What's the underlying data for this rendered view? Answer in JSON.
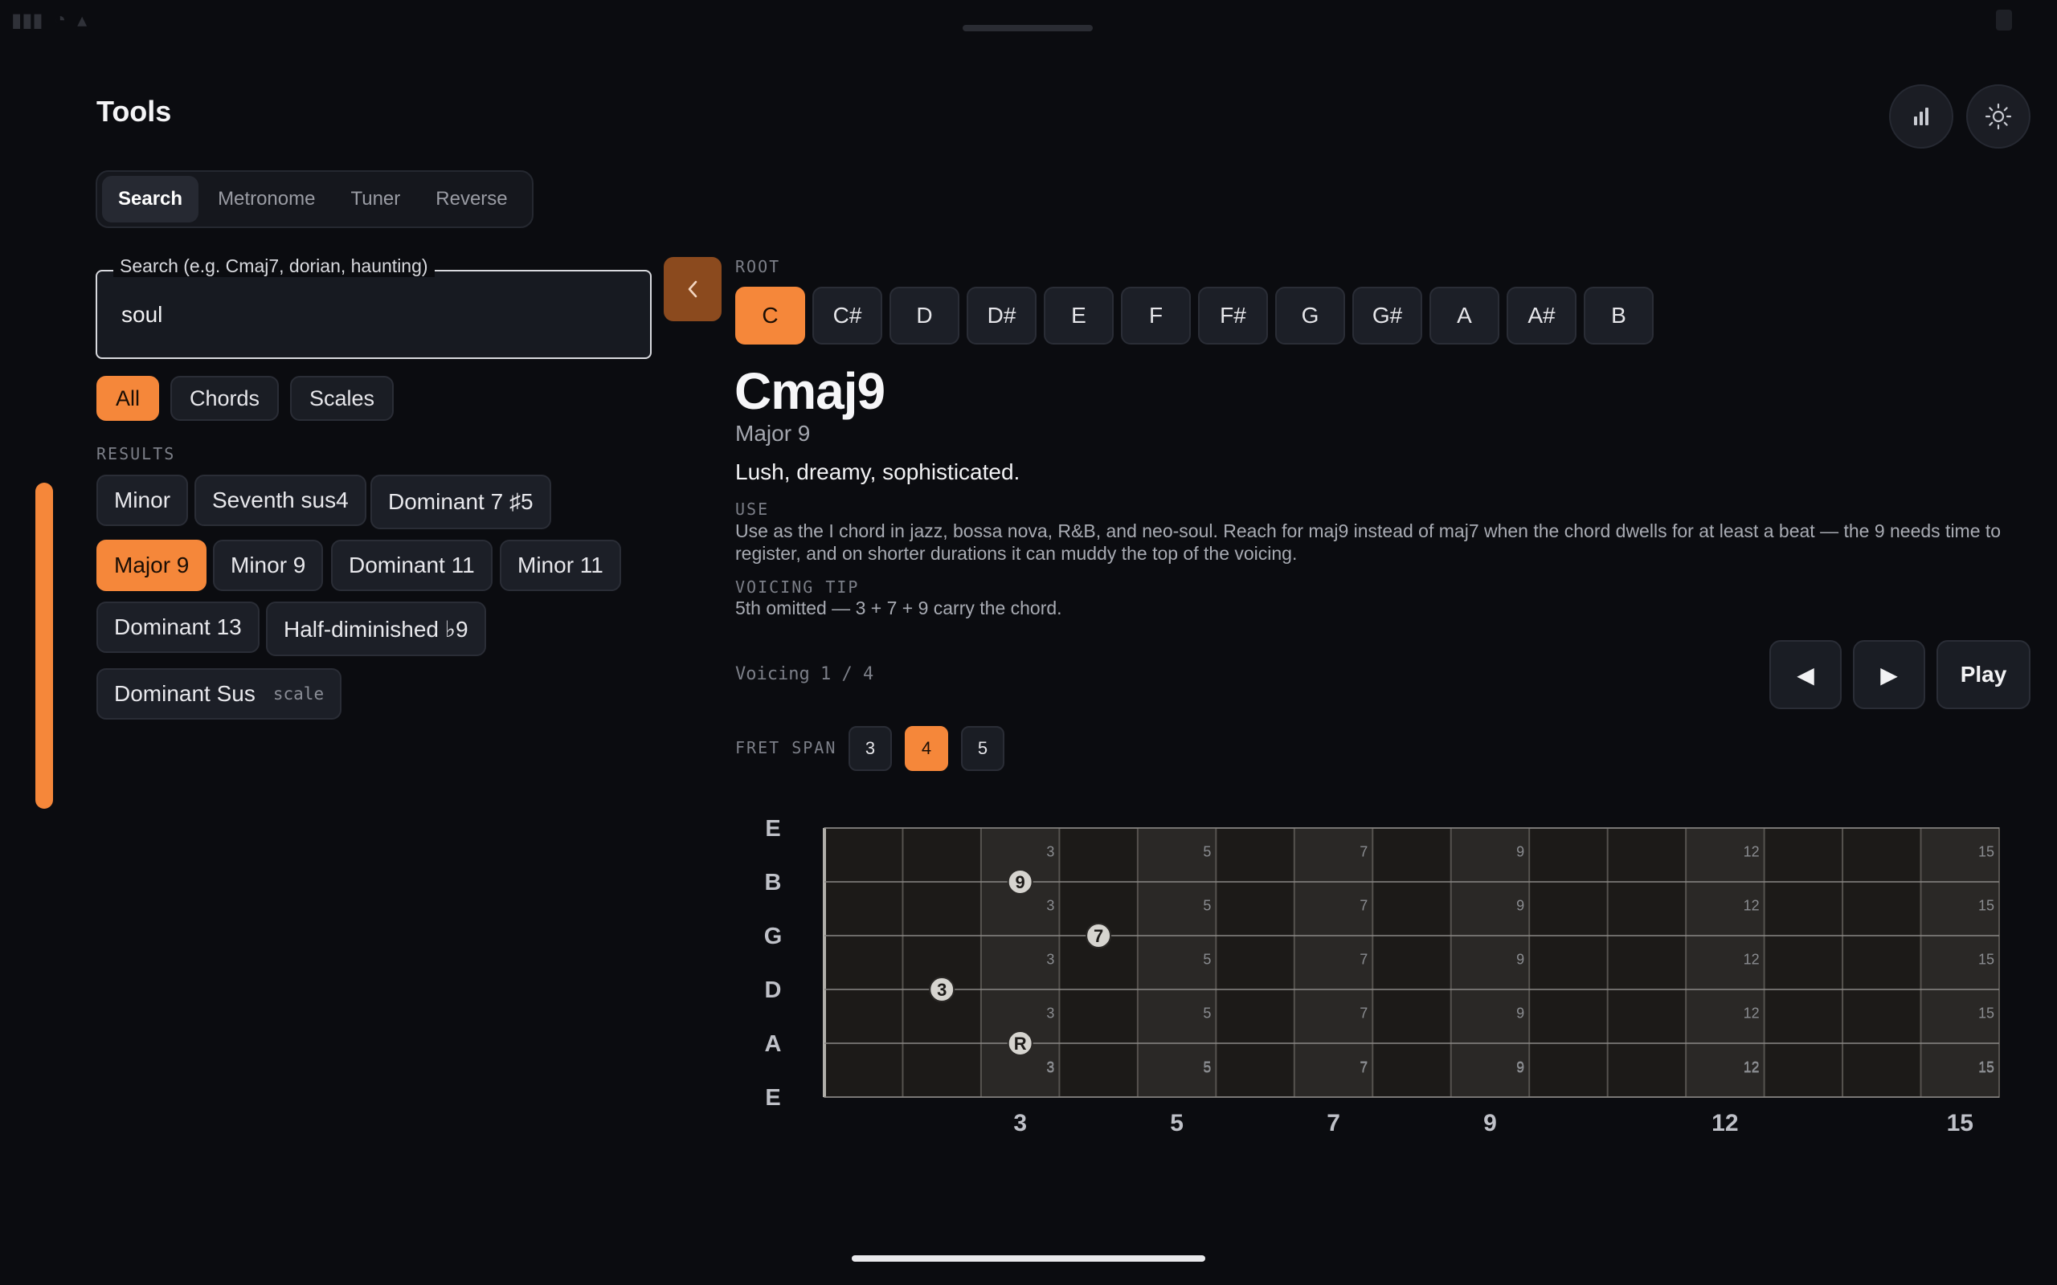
{
  "header": {
    "title": "Tools"
  },
  "tabs": [
    {
      "label": "Search",
      "active": true
    },
    {
      "label": "Metronome",
      "active": false
    },
    {
      "label": "Tuner",
      "active": false
    },
    {
      "label": "Reverse",
      "active": false
    }
  ],
  "search": {
    "label": "Search (e.g. Cmaj7, dorian, haunting)",
    "value": "soul"
  },
  "filters": {
    "all": "All",
    "chords": "Chords",
    "scales": "Scales",
    "selected": "All"
  },
  "results": {
    "label": "RESULTS",
    "items": [
      {
        "label": "Minor"
      },
      {
        "label": "Seventh sus4"
      },
      {
        "label": "Dominant 7 ♯5"
      },
      {
        "label": "Major 9",
        "active": true
      },
      {
        "label": "Minor 9"
      },
      {
        "label": "Dominant 11"
      },
      {
        "label": "Minor 11"
      },
      {
        "label": "Dominant 13"
      },
      {
        "label": "Half-diminished ♭9"
      },
      {
        "label": "Dominant Sus",
        "tag": "scale"
      }
    ]
  },
  "root": {
    "label": "ROOT",
    "keys": [
      "C",
      "C#",
      "D",
      "D#",
      "E",
      "F",
      "F#",
      "G",
      "G#",
      "A",
      "A#",
      "B"
    ],
    "selected": "C"
  },
  "chord": {
    "name": "Cmaj9",
    "full_name": "Major 9",
    "mood": "Lush, dreamy, sophisticated.",
    "use_label": "USE",
    "use_text": "Use as the I chord in jazz, bossa nova, R&B, and neo-soul. Reach for maj9 instead of maj7 when the chord dwells for at least a beat — the 9 needs time to register, and on shorter durations it can muddy the top of the voicing.",
    "voicing_tip_label": "VOICING TIP",
    "voicing_tip_text": "5th omitted — 3 + 7 + 9 carry the chord."
  },
  "voicing": {
    "counter": "Voicing 1 / 4",
    "prev_label": "◀",
    "next_label": "▶",
    "play_label": "Play"
  },
  "fret_span": {
    "label": "FRET SPAN",
    "options": [
      "3",
      "4",
      "5"
    ],
    "selected": "4"
  },
  "fretboard": {
    "strings": [
      "E",
      "B",
      "G",
      "D",
      "A",
      "E"
    ],
    "fret_count": 15,
    "inlay_frets": [
      3,
      5,
      7,
      9,
      12,
      15
    ],
    "inlay_labels": [
      "3",
      "5",
      "7",
      "9",
      "12",
      "15"
    ],
    "notes": [
      {
        "string": "B",
        "fret": 3,
        "label": "9"
      },
      {
        "string": "G",
        "fret": 4,
        "label": "7"
      },
      {
        "string": "D",
        "fret": 2,
        "label": "3"
      },
      {
        "string": "A",
        "fret": 3,
        "label": "R"
      }
    ]
  },
  "colors": {
    "accent": "#f5873a",
    "background": "#0b0c10",
    "surface": "#1c1f27"
  }
}
